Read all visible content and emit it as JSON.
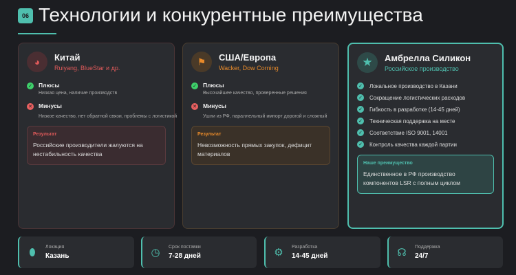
{
  "header": {
    "number": "06",
    "title": "Технологии и конкурентные преимущества"
  },
  "colors": {
    "accent": "#4fbfae",
    "china": "#e05a5a",
    "usa": "#e88a2a"
  },
  "cards": [
    {
      "name": "Китай",
      "sub": "Ruiyang, BlueStar и др.",
      "icon": "globe-icon",
      "plus_label": "Плюсы",
      "plus": "Низкая цена, наличие производств",
      "minus_label": "Минусы",
      "minus": "Низкое качество, нет обратной связи, проблемы с логистикой",
      "result_label": "Результат",
      "result": "Российские производители жалуются на нестабильность качества"
    },
    {
      "name": "США/Европа",
      "sub": "Wacker, Dow Corning",
      "icon": "flag-icon",
      "plus_label": "Плюсы",
      "plus": "Высочайшее качество, проверенные решения",
      "minus_label": "Минусы",
      "minus": "Ушли из РФ, параллельный импорт дорогой и сложный",
      "result_label": "Результат",
      "result": "Невозможность прямых закупок, дефицит материалов"
    }
  ],
  "ours": {
    "name": "Амбрелла Силикон",
    "sub": "Российское производство",
    "icon": "star-icon",
    "items": [
      "Локальное производство в Казани",
      "Сокращение логистических расходов",
      "Гибкость в разработке (14-45 дней)",
      "Техническая поддержка на месте",
      "Соответствие ISO 9001, 14001",
      "Контроль качества каждой партии"
    ],
    "adv_label": "Наше преимущество",
    "adv": "Единственное в РФ производство компонентов LSR с полным циклом"
  },
  "stats": [
    {
      "label": "Локация",
      "value": "Казань",
      "icon": "map-pin-icon"
    },
    {
      "label": "Срок поставки",
      "value": "7-28 дней",
      "icon": "clock-icon"
    },
    {
      "label": "Разработка",
      "value": "14-45 дней",
      "icon": "gears-icon"
    },
    {
      "label": "Поддержка",
      "value": "24/7",
      "icon": "headset-icon"
    }
  ]
}
